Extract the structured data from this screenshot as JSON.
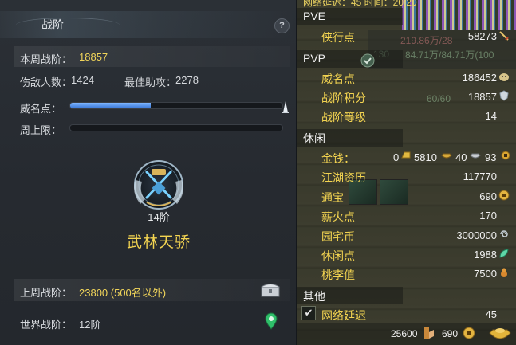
{
  "left_panel": {
    "title": "战阶",
    "help_label": "?",
    "weekly_rank_label": "本周战阶：",
    "weekly_rank_value": "18857",
    "kills_label": "伤敌人数：",
    "kills_value": "1424",
    "assists_label": "最佳助攻：",
    "assists_value": "2278",
    "prestige_label": "威名点：",
    "prestige_progress": 0.38,
    "weekly_cap_label": "周上限：",
    "weekly_cap_progress": 0.0,
    "rank_level": "14阶",
    "rank_name": "武林天骄",
    "last_week_label": "上周战阶：",
    "last_week_value": "23800 (500名以外)",
    "world_rank_label": "世界战阶：",
    "world_rank_value": "12阶"
  },
  "right_panel": {
    "top_status": "网络延迟：45   时间：20:20",
    "ghost_hp": "219.86万/28",
    "ghost_mp": "84.71万/84.71万(100",
    "ghost_level": "130",
    "ghost_ratio": "60/60",
    "pve": {
      "title": "PVE",
      "items": [
        {
          "label": "侠行点",
          "value": "58273",
          "icon": "sword-icon"
        }
      ]
    },
    "pvp": {
      "title": "PVP",
      "items": [
        {
          "label": "威名点",
          "value": "186452",
          "icon": "prestige-mask-icon"
        },
        {
          "label": "战阶积分",
          "value": "18857",
          "icon": "crest-icon"
        },
        {
          "label": "战阶等级",
          "value": "14"
        }
      ]
    },
    "leisure": {
      "title": "休闲",
      "money_label": "金钱：",
      "money_gold": "0",
      "money_silver": "5810",
      "money_copper": "40",
      "money_ingot": "93",
      "items": [
        {
          "label": "江湖资历",
          "value": "117770"
        },
        {
          "label": "通宝",
          "value": "690",
          "icon": "coin-icon"
        },
        {
          "label": "薪火点",
          "value": "170"
        },
        {
          "label": "园宅币",
          "value": "3000000",
          "icon": "swirl-icon"
        },
        {
          "label": "休闲点",
          "value": "1988",
          "icon": "leaf-icon"
        },
        {
          "label": "桃李值",
          "value": "7500",
          "icon": "gourd-icon"
        }
      ]
    },
    "other": {
      "title": "其他",
      "latency_label": "网络延迟",
      "latency_value": "45",
      "latency_checked": true
    },
    "footer": {
      "stamina_value": "25600",
      "coin_value": "690"
    }
  },
  "colors": {
    "accent_yellow": "#f3d451",
    "progress_blue": "#3573d4",
    "panel_bg": "#262a30"
  }
}
